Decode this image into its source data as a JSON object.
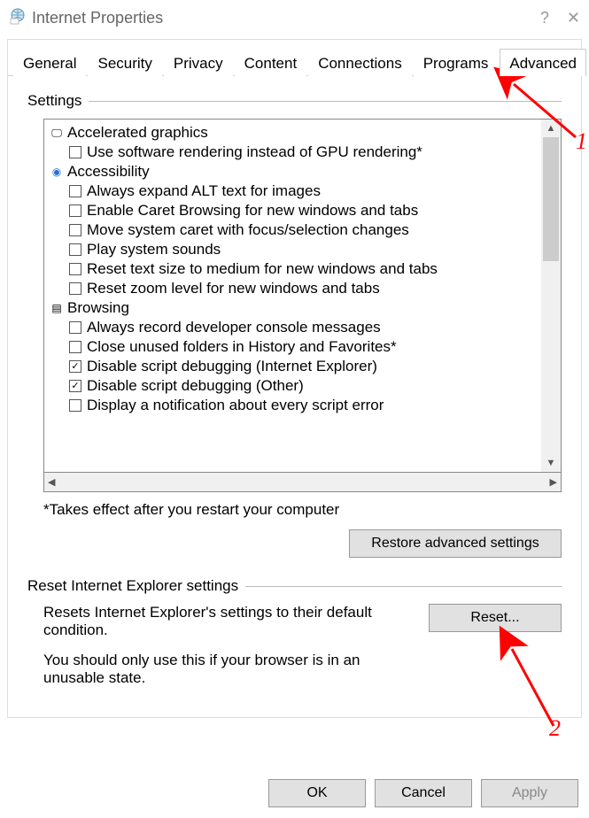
{
  "window": {
    "title": "Internet Properties"
  },
  "tabs": [
    "General",
    "Security",
    "Privacy",
    "Content",
    "Connections",
    "Programs",
    "Advanced"
  ],
  "active_tab": "Advanced",
  "settings": {
    "label": "Settings",
    "groups": [
      {
        "name": "Accelerated graphics",
        "icon": "monitor",
        "items": [
          {
            "label": "Use software rendering instead of GPU rendering*",
            "checked": false
          }
        ]
      },
      {
        "name": "Accessibility",
        "icon": "accessibility",
        "items": [
          {
            "label": "Always expand ALT text for images",
            "checked": false
          },
          {
            "label": "Enable Caret Browsing for new windows and tabs",
            "checked": false
          },
          {
            "label": "Move system caret with focus/selection changes",
            "checked": false
          },
          {
            "label": "Play system sounds",
            "checked": false
          },
          {
            "label": "Reset text size to medium for new windows and tabs",
            "checked": false
          },
          {
            "label": "Reset zoom level for new windows and tabs",
            "checked": false
          }
        ]
      },
      {
        "name": "Browsing",
        "icon": "page",
        "items": [
          {
            "label": "Always record developer console messages",
            "checked": false
          },
          {
            "label": "Close unused folders in History and Favorites*",
            "checked": false
          },
          {
            "label": "Disable script debugging (Internet Explorer)",
            "checked": true
          },
          {
            "label": "Disable script debugging (Other)",
            "checked": true
          },
          {
            "label": "Display a notification about every script error",
            "checked": false
          }
        ]
      }
    ],
    "footnote": "*Takes effect after you restart your computer",
    "restore_button": "Restore advanced settings"
  },
  "reset_section": {
    "label": "Reset Internet Explorer settings",
    "line1": "Resets Internet Explorer's settings to their default condition.",
    "line2": "You should only use this if your browser is in an unusable state.",
    "button": "Reset..."
  },
  "buttons": {
    "ok": "OK",
    "cancel": "Cancel",
    "apply": "Apply"
  },
  "annotations": {
    "n1": "1",
    "n2": "2"
  }
}
